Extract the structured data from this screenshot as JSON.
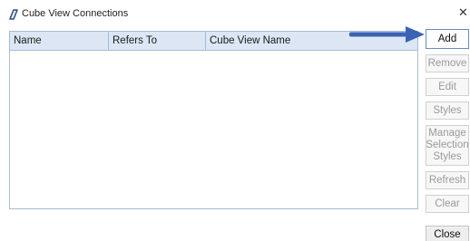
{
  "window": {
    "title": "Cube View Connections",
    "app_icon": "cube-view-app-icon",
    "close_glyph": "✕"
  },
  "grid": {
    "columns": [
      "Name",
      "Refers To",
      "Cube View Name"
    ],
    "rows": []
  },
  "buttons": {
    "add": "Add",
    "remove": "Remove",
    "edit": "Edit",
    "styles": "Styles",
    "manage_line1": "Manage",
    "manage_line2": "Selection",
    "manage_line3": "Styles",
    "refresh": "Refresh",
    "clear": "Clear",
    "close": "Close"
  },
  "annotation": {
    "icon": "arrow-right-icon",
    "color": "#3b63b5"
  },
  "colors": {
    "header_bg": "#dce6f4",
    "grid_border": "#a8bbd4",
    "disabled_text": "#9a9a9a",
    "enabled_border": "#6a8bbd"
  }
}
